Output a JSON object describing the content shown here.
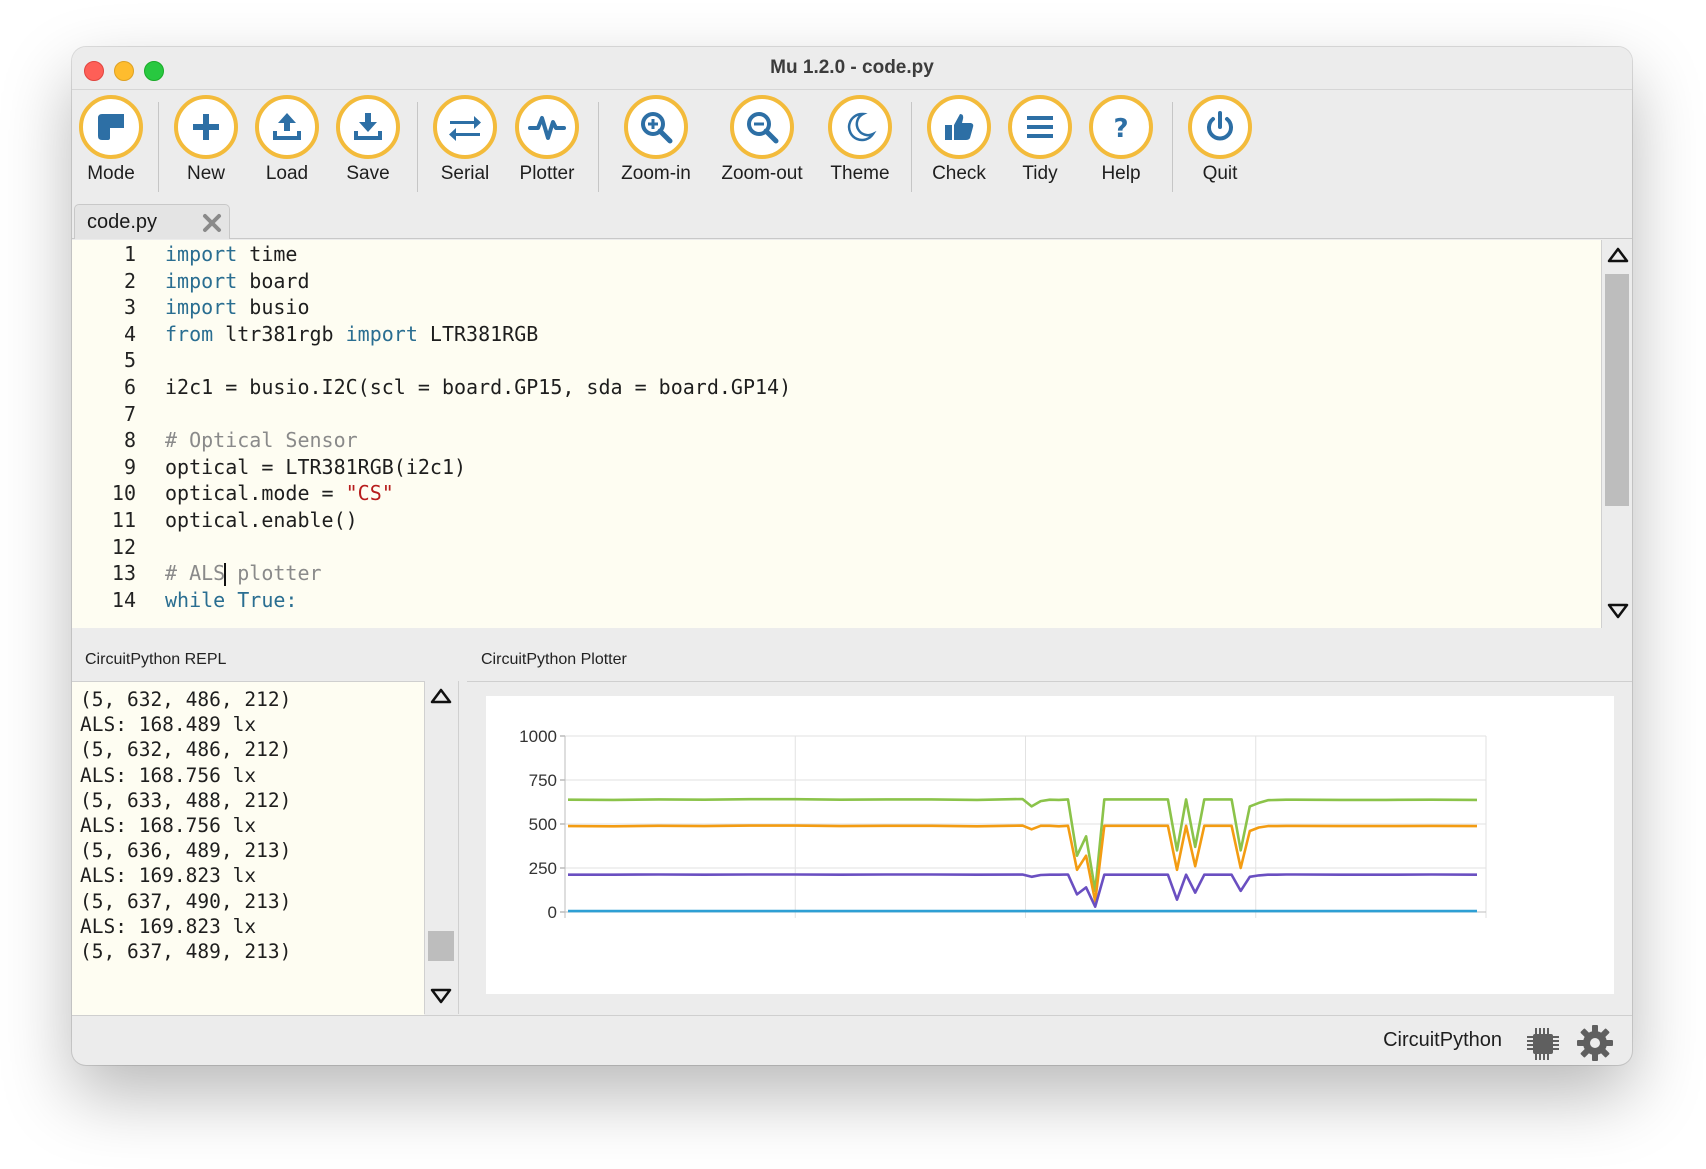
{
  "window": {
    "title": "Mu 1.2.0 - code.py"
  },
  "toolbar": {
    "buttons": [
      {
        "label": "Mode",
        "icon": "mode-icon"
      },
      {
        "label": "New",
        "icon": "plus-icon"
      },
      {
        "label": "Load",
        "icon": "upload-icon"
      },
      {
        "label": "Save",
        "icon": "download-icon"
      },
      {
        "label": "Serial",
        "icon": "swap-arrows-icon"
      },
      {
        "label": "Plotter",
        "icon": "pulse-icon"
      },
      {
        "label": "Zoom-in",
        "icon": "zoom-in-icon"
      },
      {
        "label": "Zoom-out",
        "icon": "zoom-out-icon"
      },
      {
        "label": "Theme",
        "icon": "moon-icon"
      },
      {
        "label": "Check",
        "icon": "thumbs-up-icon"
      },
      {
        "label": "Tidy",
        "icon": "lines-icon"
      },
      {
        "label": "Help",
        "icon": "question-icon"
      },
      {
        "label": "Quit",
        "icon": "power-icon"
      }
    ]
  },
  "tabs": [
    {
      "label": "code.py",
      "close_icon": "close-icon"
    }
  ],
  "editor": {
    "lines": [
      {
        "n": "1",
        "parts": [
          {
            "t": "import",
            "c": "kw"
          },
          {
            "t": " time",
            "c": ""
          }
        ]
      },
      {
        "n": "2",
        "parts": [
          {
            "t": "import",
            "c": "kw"
          },
          {
            "t": " board",
            "c": ""
          }
        ]
      },
      {
        "n": "3",
        "parts": [
          {
            "t": "import",
            "c": "kw"
          },
          {
            "t": " busio",
            "c": ""
          }
        ]
      },
      {
        "n": "4",
        "parts": [
          {
            "t": "from",
            "c": "kw"
          },
          {
            "t": " ltr381rgb ",
            "c": ""
          },
          {
            "t": "import",
            "c": "kw"
          },
          {
            "t": " LTR381RGB",
            "c": ""
          }
        ]
      },
      {
        "n": "5",
        "parts": []
      },
      {
        "n": "6",
        "parts": [
          {
            "t": "i2c1 = busio.I2C(scl = board.GP15, sda = board.GP14)",
            "c": ""
          }
        ]
      },
      {
        "n": "7",
        "parts": []
      },
      {
        "n": "8",
        "parts": [
          {
            "t": "# Optical Sensor",
            "c": "cm"
          }
        ]
      },
      {
        "n": "9",
        "parts": [
          {
            "t": "optical = LTR381RGB(i2c1)",
            "c": ""
          }
        ]
      },
      {
        "n": "10",
        "parts": [
          {
            "t": "optical.mode = ",
            "c": ""
          },
          {
            "t": "\"CS\"",
            "c": "st"
          }
        ]
      },
      {
        "n": "11",
        "parts": [
          {
            "t": "optical.enable()",
            "c": ""
          }
        ]
      },
      {
        "n": "12",
        "parts": []
      },
      {
        "n": "13",
        "parts": [
          {
            "t": "# ALS",
            "c": "cm"
          },
          {
            "t": "",
            "c": "caret"
          },
          {
            "t": " plotter",
            "c": "cm"
          }
        ]
      },
      {
        "n": "14",
        "parts": [
          {
            "t": "while True:",
            "c": "kw"
          }
        ]
      }
    ]
  },
  "repl": {
    "title": "CircuitPython REPL",
    "lines": [
      "(5, 632, 486, 212)",
      "ALS: 168.489 lx",
      "(5, 632, 486, 212)",
      "ALS: 168.756 lx",
      "(5, 633, 488, 212)",
      "ALS: 168.756 lx",
      "(5, 636, 489, 213)",
      "ALS: 169.823 lx",
      "(5, 637, 490, 213)",
      "ALS: 169.823 lx",
      "(5, 637, 489, 213)"
    ]
  },
  "plotter": {
    "title": "CircuitPython Plotter"
  },
  "status": {
    "mode": "CircuitPython",
    "board_icon": "chip-icon",
    "settings_icon": "gear-icon"
  },
  "colors": {
    "accent": "#f3bb3b",
    "icon": "#2d6fa5",
    "editor_bg": "#fefdf2"
  },
  "chart_data": {
    "type": "line",
    "yticks": [
      0,
      250,
      500,
      750,
      1000
    ],
    "ylim": [
      0,
      1000
    ],
    "x": [
      0,
      5,
      10,
      15,
      20,
      25,
      30,
      35,
      40,
      45,
      50,
      51,
      52,
      53,
      54,
      55,
      56,
      57,
      58,
      59,
      60,
      61,
      62,
      63,
      64,
      65,
      66,
      67,
      68,
      69,
      70,
      71,
      72,
      73,
      74,
      75,
      76,
      77,
      78,
      79,
      80,
      85,
      90,
      95,
      100
    ],
    "series": [
      {
        "color": "#8bc34a",
        "values": [
          638,
          637,
          640,
          638,
          641,
          641,
          638,
          640,
          640,
          637,
          642,
          600,
          630,
          638,
          637,
          640,
          320,
          430,
          120,
          640,
          640,
          640,
          640,
          640,
          640,
          640,
          640,
          350,
          640,
          370,
          640,
          640,
          640,
          640,
          350,
          600,
          620,
          635,
          637,
          638,
          638,
          637,
          637,
          638,
          637
        ]
      },
      {
        "color": "#f39c12",
        "values": [
          488,
          487,
          490,
          488,
          491,
          491,
          488,
          490,
          490,
          487,
          491,
          470,
          490,
          490,
          487,
          490,
          240,
          320,
          60,
          490,
          490,
          490,
          490,
          490,
          490,
          490,
          490,
          240,
          490,
          260,
          490,
          490,
          490,
          490,
          250,
          460,
          480,
          488,
          488,
          489,
          489,
          488,
          488,
          489,
          488
        ]
      },
      {
        "color": "#6a4fc1",
        "values": [
          212,
          212,
          213,
          212,
          213,
          213,
          212,
          213,
          213,
          212,
          213,
          200,
          210,
          212,
          212,
          213,
          100,
          140,
          30,
          212,
          212,
          212,
          212,
          212,
          212,
          212,
          212,
          70,
          212,
          110,
          212,
          212,
          212,
          212,
          120,
          200,
          208,
          212,
          212,
          213,
          213,
          212,
          212,
          213,
          212
        ]
      },
      {
        "color": "#2e9fd4",
        "values": [
          5,
          5,
          5,
          5,
          5,
          5,
          5,
          5,
          5,
          5,
          5,
          5,
          5,
          5,
          5,
          5,
          5,
          5,
          5,
          5,
          5,
          5,
          5,
          5,
          5,
          5,
          5,
          5,
          5,
          5,
          5,
          5,
          5,
          5,
          5,
          5,
          5,
          5,
          5,
          5,
          5,
          5,
          5,
          5,
          5
        ]
      }
    ]
  }
}
